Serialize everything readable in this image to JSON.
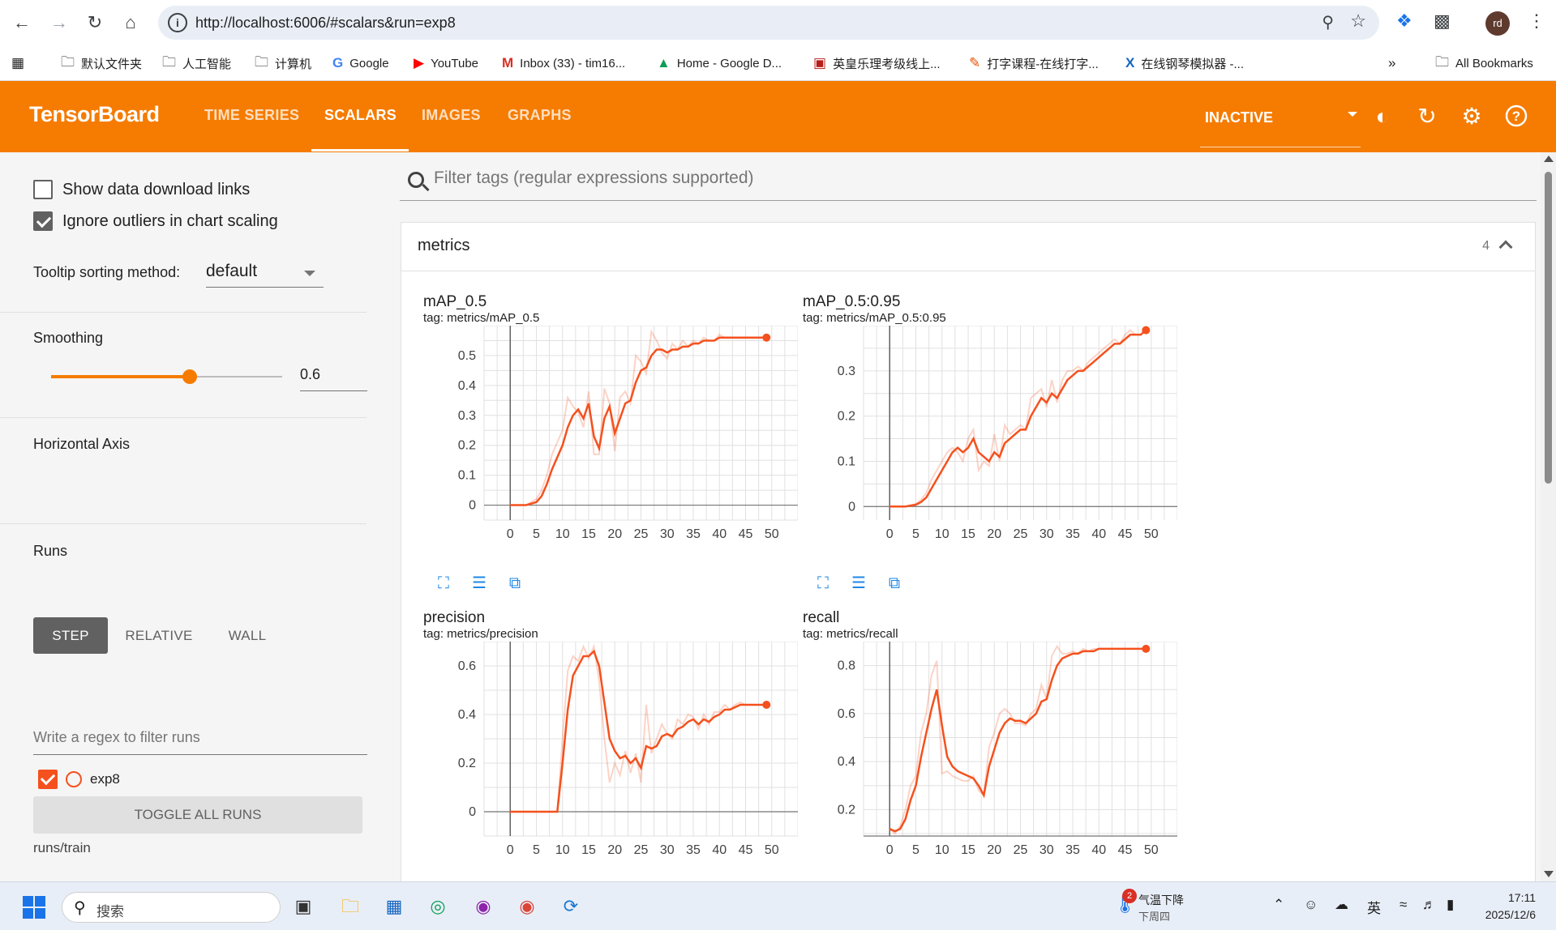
{
  "browser": {
    "url": "http://localhost:6006/#scalars&run=exp8",
    "profile_initials": "rd",
    "bookmarks": [
      {
        "icon": "folder-icon",
        "label": "默认文件夹"
      },
      {
        "icon": "folder-icon",
        "label": "人工智能"
      },
      {
        "icon": "folder-icon",
        "label": "计算机"
      },
      {
        "icon": "google-icon",
        "label": "Google"
      },
      {
        "icon": "youtube-icon",
        "label": "YouTube"
      },
      {
        "icon": "gmail-icon",
        "label": "Inbox (33) - tim16..."
      },
      {
        "icon": "drive-icon",
        "label": "Home - Google D..."
      },
      {
        "icon": "abrsm-icon",
        "label": "英皇乐理考级线上..."
      },
      {
        "icon": "typing-icon",
        "label": "打字课程-在线打字..."
      },
      {
        "icon": "piano-icon",
        "label": "在线钢琴模拟器 -..."
      }
    ],
    "all_bookmarks": "All Bookmarks"
  },
  "header": {
    "logo": "TensorBoard",
    "tabs": [
      {
        "label": "TIME SERIES",
        "active": false
      },
      {
        "label": "SCALARS",
        "active": true
      },
      {
        "label": "IMAGES",
        "active": false
      },
      {
        "label": "GRAPHS",
        "active": false
      }
    ],
    "status": "INACTIVE",
    "accent_color": "#f57c00"
  },
  "sidebar": {
    "show_download": "Show data download links",
    "show_download_checked": false,
    "ignore_outliers": "Ignore outliers in chart scaling",
    "ignore_outliers_checked": true,
    "tooltip_label": "Tooltip sorting method:",
    "tooltip_value": "default",
    "smoothing_label": "Smoothing",
    "smoothing_value": "0.6",
    "smoothing_fraction": 0.6,
    "horizontal_axis_label": "Horizontal Axis",
    "axis_options": [
      "STEP",
      "RELATIVE",
      "WALL"
    ],
    "axis_selected": "STEP",
    "runs_label": "Runs",
    "runs_filter_placeholder": "Write a regex to filter runs",
    "run_name": "exp8",
    "toggle_all": "TOGGLE ALL RUNS",
    "run_dir": "runs/train"
  },
  "main": {
    "filter_placeholder": "Filter tags (regular expressions supported)",
    "section_name": "metrics",
    "section_count": "4"
  },
  "chart_data": [
    {
      "type": "line",
      "title": "mAP_0.5",
      "tag": "tag: metrics/mAP_0.5",
      "xlim": [
        -5,
        55
      ],
      "ylim": [
        -0.05,
        0.6
      ],
      "xticks": [
        0,
        5,
        10,
        15,
        20,
        25,
        30,
        35,
        40,
        45,
        50
      ],
      "yticks": [
        0,
        0.1,
        0.2,
        0.3,
        0.4,
        0.5
      ],
      "ytick_labels": [
        "0",
        "0.1",
        "0.2",
        "0.3",
        "0.4",
        "0.5"
      ],
      "color": "#f4511e",
      "x": [
        0,
        1,
        2,
        3,
        4,
        5,
        6,
        7,
        8,
        9,
        10,
        11,
        12,
        13,
        14,
        15,
        16,
        17,
        18,
        19,
        20,
        21,
        22,
        23,
        24,
        25,
        26,
        27,
        28,
        29,
        30,
        31,
        32,
        33,
        34,
        35,
        36,
        37,
        38,
        39,
        40,
        41,
        42,
        43,
        44,
        45,
        46,
        47,
        48,
        49
      ],
      "smoothed": [
        0,
        0,
        0,
        0,
        0.005,
        0.01,
        0.03,
        0.07,
        0.12,
        0.16,
        0.2,
        0.26,
        0.3,
        0.32,
        0.29,
        0.34,
        0.23,
        0.19,
        0.29,
        0.33,
        0.24,
        0.29,
        0.34,
        0.35,
        0.41,
        0.45,
        0.46,
        0.5,
        0.52,
        0.52,
        0.51,
        0.52,
        0.52,
        0.53,
        0.53,
        0.54,
        0.54,
        0.55,
        0.55,
        0.55,
        0.56,
        0.56,
        0.56,
        0.56,
        0.56,
        0.56,
        0.56,
        0.56,
        0.56,
        0.56
      ],
      "raw": [
        0,
        0,
        0,
        0,
        0.01,
        0.02,
        0.05,
        0.1,
        0.17,
        0.21,
        0.25,
        0.36,
        0.33,
        0.31,
        0.26,
        0.38,
        0.17,
        0.17,
        0.39,
        0.34,
        0.18,
        0.36,
        0.38,
        0.34,
        0.5,
        0.48,
        0.44,
        0.58,
        0.55,
        0.51,
        0.49,
        0.54,
        0.52,
        0.55,
        0.53,
        0.55,
        0.54,
        0.56,
        0.55,
        0.55,
        0.57,
        0.56,
        0.56,
        0.56,
        0.56,
        0.56,
        0.56,
        0.56,
        0.56,
        0.56
      ]
    },
    {
      "type": "line",
      "title": "mAP_0.5:0.95",
      "tag": "tag: metrics/mAP_0.5:0.95",
      "xlim": [
        -5,
        55
      ],
      "ylim": [
        -0.03,
        0.4
      ],
      "xticks": [
        0,
        5,
        10,
        15,
        20,
        25,
        30,
        35,
        40,
        45,
        50
      ],
      "yticks": [
        0,
        0.1,
        0.2,
        0.3
      ],
      "ytick_labels": [
        "0",
        "0.1",
        "0.2",
        "0.3"
      ],
      "color": "#f4511e",
      "x": [
        0,
        1,
        2,
        3,
        4,
        5,
        6,
        7,
        8,
        9,
        10,
        11,
        12,
        13,
        14,
        15,
        16,
        17,
        18,
        19,
        20,
        21,
        22,
        23,
        24,
        25,
        26,
        27,
        28,
        29,
        30,
        31,
        32,
        33,
        34,
        35,
        36,
        37,
        38,
        39,
        40,
        41,
        42,
        43,
        44,
        45,
        46,
        47,
        48,
        49
      ],
      "smoothed": [
        0,
        0,
        0,
        0,
        0.002,
        0.004,
        0.01,
        0.02,
        0.04,
        0.06,
        0.08,
        0.1,
        0.12,
        0.13,
        0.12,
        0.13,
        0.15,
        0.12,
        0.11,
        0.1,
        0.12,
        0.11,
        0.14,
        0.15,
        0.16,
        0.17,
        0.17,
        0.2,
        0.22,
        0.24,
        0.23,
        0.25,
        0.24,
        0.26,
        0.28,
        0.29,
        0.3,
        0.3,
        0.31,
        0.32,
        0.33,
        0.34,
        0.35,
        0.36,
        0.36,
        0.37,
        0.38,
        0.38,
        0.38,
        0.39
      ],
      "raw": [
        0,
        0,
        0,
        0,
        0.003,
        0.006,
        0.015,
        0.03,
        0.06,
        0.08,
        0.1,
        0.12,
        0.13,
        0.12,
        0.1,
        0.15,
        0.17,
        0.08,
        0.1,
        0.09,
        0.16,
        0.1,
        0.18,
        0.16,
        0.17,
        0.18,
        0.17,
        0.24,
        0.25,
        0.26,
        0.22,
        0.28,
        0.23,
        0.28,
        0.3,
        0.3,
        0.31,
        0.3,
        0.32,
        0.33,
        0.34,
        0.35,
        0.36,
        0.37,
        0.36,
        0.38,
        0.39,
        0.38,
        0.38,
        0.39
      ]
    },
    {
      "type": "line",
      "title": "precision",
      "tag": "tag: metrics/precision",
      "xlim": [
        -5,
        55
      ],
      "ylim": [
        -0.1,
        0.7
      ],
      "xticks": [
        0,
        5,
        10,
        15,
        20,
        25,
        30,
        35,
        40,
        45,
        50
      ],
      "yticks": [
        0,
        0.2,
        0.4,
        0.6
      ],
      "ytick_labels": [
        "0",
        "0.2",
        "0.4",
        "0.6"
      ],
      "color": "#f4511e",
      "x": [
        0,
        1,
        2,
        3,
        4,
        5,
        6,
        7,
        8,
        9,
        10,
        11,
        12,
        13,
        14,
        15,
        16,
        17,
        18,
        19,
        20,
        21,
        22,
        23,
        24,
        25,
        26,
        27,
        28,
        29,
        30,
        31,
        32,
        33,
        34,
        35,
        36,
        37,
        38,
        39,
        40,
        41,
        42,
        43,
        44,
        45,
        46,
        47,
        48,
        49
      ],
      "smoothed": [
        0,
        0,
        0,
        0,
        0,
        0,
        0,
        0,
        0,
        0,
        0.2,
        0.42,
        0.56,
        0.6,
        0.64,
        0.64,
        0.66,
        0.6,
        0.45,
        0.3,
        0.25,
        0.22,
        0.23,
        0.2,
        0.22,
        0.18,
        0.27,
        0.26,
        0.27,
        0.31,
        0.32,
        0.31,
        0.34,
        0.35,
        0.37,
        0.38,
        0.36,
        0.38,
        0.37,
        0.39,
        0.4,
        0.42,
        0.42,
        0.43,
        0.44,
        0.44,
        0.44,
        0.44,
        0.44,
        0.44
      ],
      "raw": [
        0,
        0,
        0,
        0,
        0,
        0,
        0,
        0,
        0,
        0,
        0.3,
        0.58,
        0.64,
        0.62,
        0.68,
        0.63,
        0.68,
        0.54,
        0.3,
        0.12,
        0.2,
        0.15,
        0.25,
        0.16,
        0.24,
        0.12,
        0.44,
        0.24,
        0.3,
        0.36,
        0.32,
        0.3,
        0.38,
        0.36,
        0.4,
        0.39,
        0.34,
        0.4,
        0.36,
        0.41,
        0.41,
        0.44,
        0.42,
        0.44,
        0.45,
        0.44,
        0.44,
        0.44,
        0.44,
        0.44
      ]
    },
    {
      "type": "line",
      "title": "recall",
      "tag": "tag: metrics/recall",
      "xlim": [
        -5,
        55
      ],
      "ylim": [
        0.09,
        0.9
      ],
      "xticks": [
        0,
        5,
        10,
        15,
        20,
        25,
        30,
        35,
        40,
        45,
        50
      ],
      "yticks": [
        0.2,
        0.4,
        0.6,
        0.8
      ],
      "ytick_labels": [
        "0.2",
        "0.4",
        "0.6",
        "0.8"
      ],
      "color": "#f4511e",
      "x": [
        0,
        1,
        2,
        3,
        4,
        5,
        6,
        7,
        8,
        9,
        10,
        11,
        12,
        13,
        14,
        15,
        16,
        17,
        18,
        19,
        20,
        21,
        22,
        23,
        24,
        25,
        26,
        27,
        28,
        29,
        30,
        31,
        32,
        33,
        34,
        35,
        36,
        37,
        38,
        39,
        40,
        41,
        42,
        43,
        44,
        45,
        46,
        47,
        48,
        49
      ],
      "smoothed": [
        0.12,
        0.11,
        0.12,
        0.16,
        0.24,
        0.3,
        0.42,
        0.52,
        0.62,
        0.7,
        0.55,
        0.42,
        0.38,
        0.36,
        0.35,
        0.34,
        0.33,
        0.3,
        0.26,
        0.38,
        0.45,
        0.52,
        0.56,
        0.58,
        0.57,
        0.57,
        0.56,
        0.58,
        0.6,
        0.65,
        0.66,
        0.74,
        0.8,
        0.83,
        0.84,
        0.85,
        0.85,
        0.86,
        0.86,
        0.86,
        0.87,
        0.87,
        0.87,
        0.87,
        0.87,
        0.87,
        0.87,
        0.87,
        0.87,
        0.87
      ],
      "raw": [
        0.12,
        0.1,
        0.13,
        0.2,
        0.3,
        0.34,
        0.52,
        0.6,
        0.76,
        0.82,
        0.35,
        0.36,
        0.34,
        0.33,
        0.32,
        0.32,
        0.34,
        0.28,
        0.26,
        0.46,
        0.52,
        0.6,
        0.62,
        0.6,
        0.56,
        0.56,
        0.55,
        0.6,
        0.62,
        0.72,
        0.66,
        0.84,
        0.88,
        0.85,
        0.85,
        0.86,
        0.85,
        0.87,
        0.86,
        0.87,
        0.87,
        0.87,
        0.87,
        0.87,
        0.87,
        0.87,
        0.87,
        0.87,
        0.87,
        0.87
      ]
    }
  ],
  "taskbar": {
    "search_placeholder": "搜索",
    "weather_title": "气温下降",
    "weather_sub": "下周四",
    "weather_badge": "2",
    "ime": "英",
    "time": "17:11",
    "date": "2025/12/6"
  }
}
